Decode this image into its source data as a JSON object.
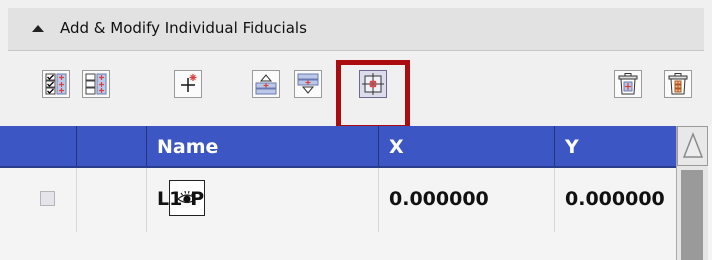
{
  "panel": {
    "title": "Add & Modify Individual Fiducials",
    "collapse_icon": "triangle-up-icon"
  },
  "toolbar": {
    "buttons": [
      {
        "icon": "select-all-icon"
      },
      {
        "icon": "deselect-all-icon"
      },
      {
        "icon": "add-fiducial-icon"
      },
      {
        "icon": "move-up-icon"
      },
      {
        "icon": "move-down-icon"
      },
      {
        "icon": "center-on-fiducial-icon",
        "highlighted": true
      },
      {
        "icon": "delete-selected-icon"
      },
      {
        "icon": "delete-all-icon"
      }
    ],
    "highlight_color": "#aa0c0f"
  },
  "table": {
    "columns": [
      "",
      "",
      "Name",
      "X",
      "Y"
    ],
    "header_color": "#3c57c3",
    "rows": [
      {
        "selected": false,
        "visible_icon": "eye-icon",
        "name": "L1-P",
        "x": "0.000000",
        "y": "0.000000"
      }
    ]
  }
}
